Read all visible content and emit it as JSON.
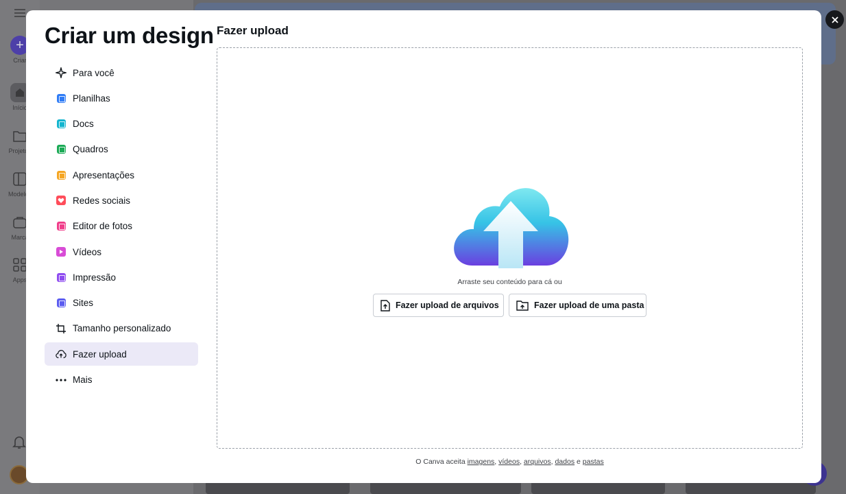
{
  "modal": {
    "title": "Criar um design",
    "categories": [
      {
        "label": "Para você",
        "icon": "sparkle-icon",
        "color": "#0e1318"
      },
      {
        "label": "Planilhas",
        "icon": "sheets-icon",
        "color": "#2f7cf6"
      },
      {
        "label": "Docs",
        "icon": "docs-icon",
        "color": "#13b5cf"
      },
      {
        "label": "Quadros",
        "icon": "whiteboard-icon",
        "color": "#1aaa55"
      },
      {
        "label": "Apresentações",
        "icon": "presentation-icon",
        "color": "#f5a623"
      },
      {
        "label": "Redes sociais",
        "icon": "heart-icon",
        "color": "#ff4d5a"
      },
      {
        "label": "Editor de fotos",
        "icon": "photo-editor-icon",
        "color": "#f03d8a"
      },
      {
        "label": "Vídeos",
        "icon": "video-icon",
        "color": "#d84cd6"
      },
      {
        "label": "Impressão",
        "icon": "print-icon",
        "color": "#8f4cf0"
      },
      {
        "label": "Sites",
        "icon": "website-icon",
        "color": "#5b5cf0"
      },
      {
        "label": "Tamanho personalizado",
        "icon": "custom-size-icon",
        "color": "#0e1318"
      },
      {
        "label": "Fazer upload",
        "icon": "cloud-upload-icon",
        "color": "#0e1318",
        "active": true
      },
      {
        "label": "Mais",
        "icon": "more-icon",
        "color": "#0e1318"
      }
    ],
    "upload": {
      "title": "Fazer upload",
      "drag_text": "Arraste seu conteúdo para cá ou",
      "btn_files": "Fazer upload de arquivos",
      "btn_folder": "Fazer upload de uma pasta",
      "accepts_prefix": "O Canva aceita",
      "accepts_links": [
        "imagens",
        "vídeos",
        "arquivos",
        "dados",
        "pastas"
      ],
      "accepts_and": "e"
    }
  },
  "rail": {
    "create_label": "Criar",
    "items": [
      "Início",
      "Projetos",
      "Modelos",
      "Marca",
      "Apps"
    ]
  }
}
